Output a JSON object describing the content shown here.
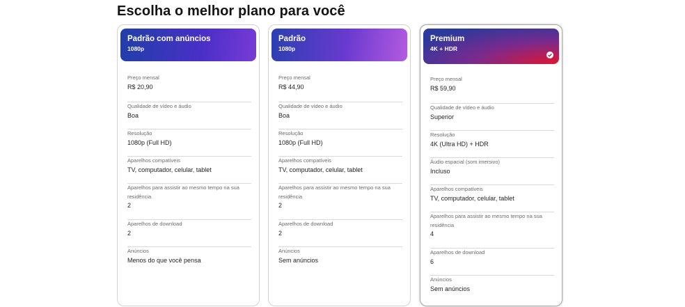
{
  "page": {
    "title": "Escolha o melhor plano para você"
  },
  "plans": [
    {
      "name": "Padrão com anúncios",
      "resolution_badge": "1080p",
      "gradient": [
        "#1f3fa8",
        "#4a2fc7",
        "#7a3bd6"
      ],
      "selected": false,
      "features": [
        {
          "label": "Preço mensal",
          "value": "R$ 20,90"
        },
        {
          "label": "Qualidade de vídeo e áudio",
          "value": "Boa"
        },
        {
          "label": "Resolução",
          "value": "1080p (Full HD)"
        },
        {
          "label": "Aparelhos compatíveis",
          "value": "TV, computador, celular, tablet"
        },
        {
          "label": "Aparelhos para assistir ao mesmo tempo na sua residência",
          "value": "2"
        },
        {
          "label": "Aparelhos de download",
          "value": "2"
        },
        {
          "label": "Anúncios",
          "value": "Menos do que você pensa"
        }
      ]
    },
    {
      "name": "Padrão",
      "resolution_badge": "1080p",
      "gradient": [
        "#2a3fb0",
        "#6a3ad0",
        "#b45be0"
      ],
      "selected": false,
      "features": [
        {
          "label": "Preço mensal",
          "value": "R$ 44,90"
        },
        {
          "label": "Qualidade de vídeo e áudio",
          "value": "Boa"
        },
        {
          "label": "Resolução",
          "value": "1080p (Full HD)"
        },
        {
          "label": "Aparelhos compatíveis",
          "value": "TV, computador, celular, tablet"
        },
        {
          "label": "Aparelhos para assistir ao mesmo tempo na sua residência",
          "value": "2"
        },
        {
          "label": "Aparelhos de download",
          "value": "2"
        },
        {
          "label": "Anúncios",
          "value": "Sem anúncios"
        }
      ]
    },
    {
      "name": "Premium",
      "resolution_badge": "4K + HDR",
      "gradient": [
        "#2b3a9c",
        "#7a2a8e",
        "#e01630"
      ],
      "selected": true,
      "features": [
        {
          "label": "Preço mensal",
          "value": "R$ 59,90"
        },
        {
          "label": "Qualidade de vídeo e áudio",
          "value": "Superior"
        },
        {
          "label": "Resolução",
          "value": "4K (Ultra HD) + HDR"
        },
        {
          "label": "Áudio espacial (som imersivo)",
          "value": "Incluso"
        },
        {
          "label": "Aparelhos compatíveis",
          "value": "TV, computador, celular, tablet"
        },
        {
          "label": "Aparelhos para assistir ao mesmo tempo na sua residência",
          "value": "4"
        },
        {
          "label": "Aparelhos de download",
          "value": "6"
        },
        {
          "label": "Anúncios",
          "value": "Sem anúncios"
        }
      ]
    }
  ]
}
